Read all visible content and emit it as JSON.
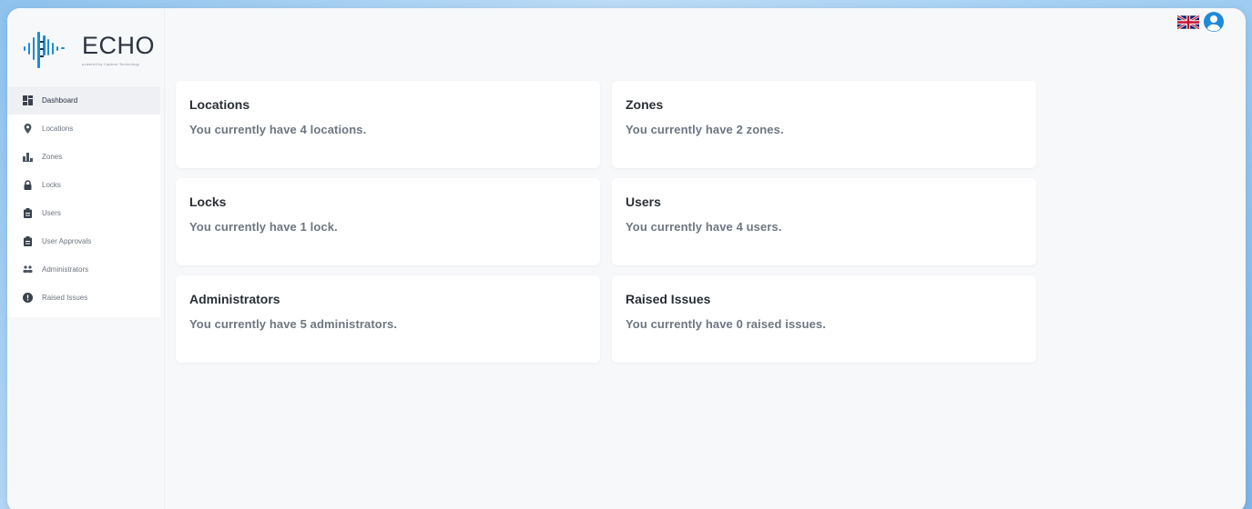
{
  "brand": {
    "name": "ECHO",
    "tagline": "powered by Capture Technology"
  },
  "colors": {
    "accent": "#1f8ad8",
    "icon": "#4a5260",
    "card_bg": "#ffffff",
    "page_bg": "#f7f8fa"
  },
  "header": {
    "language_icon": "uk-flag-icon",
    "profile_icon": "user-circle-icon"
  },
  "sidebar": {
    "items": [
      {
        "label": "Dashboard",
        "icon": "dashboard-icon",
        "active": true
      },
      {
        "label": "Locations",
        "icon": "map-pin-icon",
        "active": false
      },
      {
        "label": "Zones",
        "icon": "zones-icon",
        "active": false
      },
      {
        "label": "Locks",
        "icon": "lock-icon",
        "active": false
      },
      {
        "label": "Users",
        "icon": "clipboard-icon",
        "active": false
      },
      {
        "label": "User Approvals",
        "icon": "clipboard-check-icon",
        "active": false
      },
      {
        "label": "Administrators",
        "icon": "users-icon",
        "active": false
      },
      {
        "label": "Raised Issues",
        "icon": "alert-circle-icon",
        "active": false
      }
    ]
  },
  "cards": [
    {
      "title": "Locations",
      "text": "You currently have 4 locations."
    },
    {
      "title": "Zones",
      "text": "You currently have 2 zones."
    },
    {
      "title": "Locks",
      "text": "You currently have 1 lock."
    },
    {
      "title": "Users",
      "text": "You currently have 4 users."
    },
    {
      "title": "Administrators",
      "text": "You currently have 5 administrators."
    },
    {
      "title": "Raised Issues",
      "text": "You currently have 0 raised issues."
    }
  ]
}
